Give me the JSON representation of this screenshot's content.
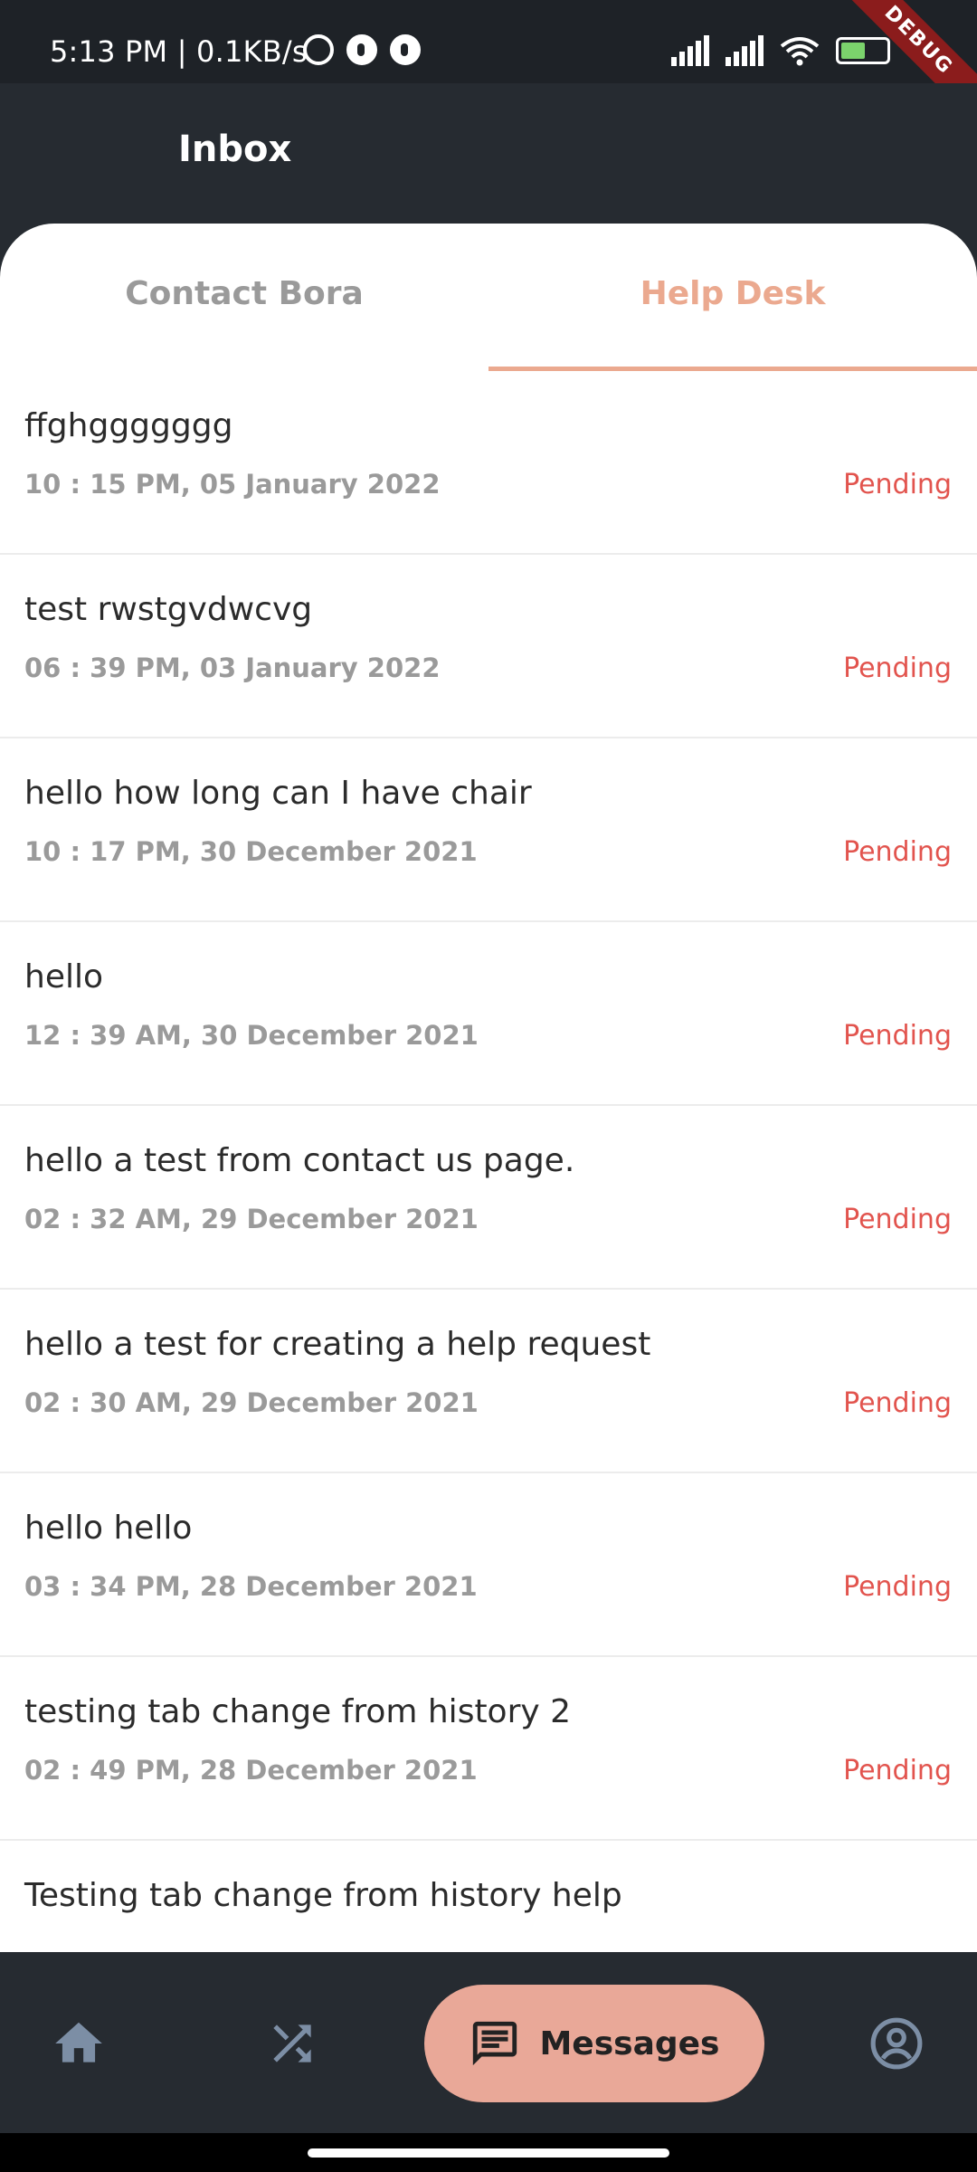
{
  "status_bar": {
    "time_speed": "5:13 PM | 0.1KB/s",
    "battery": "66",
    "debug_badge": "DEBUG"
  },
  "app_bar": {
    "title": "Inbox"
  },
  "tabs": [
    {
      "label": "Contact Bora",
      "active": false
    },
    {
      "label": "Help Desk",
      "active": true
    }
  ],
  "messages": [
    {
      "title": "ffghggggggg",
      "date": "10 : 15 PM, 05 January 2022",
      "status": "Pending"
    },
    {
      "title": "test rwstgvdwcvg",
      "date": "06 : 39 PM, 03 January 2022",
      "status": "Pending"
    },
    {
      "title": "hello how long can I have chair",
      "date": "10 : 17 PM, 30 December 2021",
      "status": "Pending"
    },
    {
      "title": "hello",
      "date": "12 : 39 AM, 30 December 2021",
      "status": "Pending"
    },
    {
      "title": "hello a test from contact us page.",
      "date": "02 : 32 AM, 29 December 2021",
      "status": "Pending"
    },
    {
      "title": "hello a test for creating a help request",
      "date": "02 : 30 AM, 29 December 2021",
      "status": "Pending"
    },
    {
      "title": "hello hello",
      "date": "03 : 34 PM, 28 December 2021",
      "status": "Pending"
    },
    {
      "title": "testing tab change from history 2",
      "date": "02 : 49 PM, 28 December 2021",
      "status": "Pending"
    },
    {
      "title": "Testing tab change from history help",
      "date": "",
      "status": ""
    }
  ],
  "bottom_nav": {
    "items": [
      {
        "icon": "home-icon"
      },
      {
        "icon": "shuffle-icon"
      },
      {
        "icon": "message-icon",
        "label": "Messages",
        "active": true
      },
      {
        "icon": "profile-icon"
      }
    ]
  },
  "colors": {
    "accent": "#eba98f",
    "pending": "#e2544e",
    "header_bg": "#262b31"
  }
}
